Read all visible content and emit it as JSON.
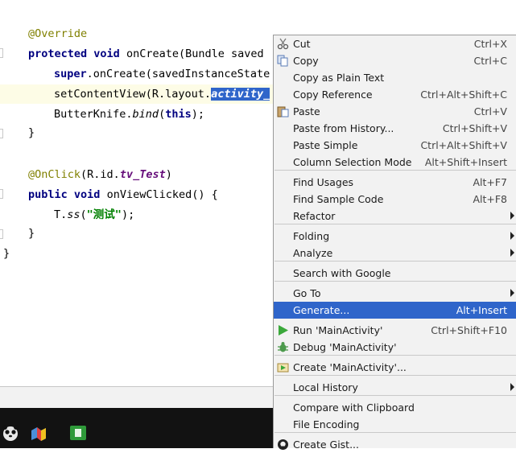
{
  "editor": {
    "lines": [
      {
        "parts": [
          {
            "t": "@Override",
            "c": "ann"
          }
        ]
      },
      {
        "parts": [
          {
            "t": "protected",
            "c": "kw"
          },
          {
            "t": " "
          },
          {
            "t": "void",
            "c": "kw"
          },
          {
            "t": " onCreate(Bundle saved"
          }
        ]
      },
      {
        "parts": [
          {
            "t": "super",
            "c": "kw"
          },
          {
            "t": ".onCreate(savedInstanceState"
          }
        ]
      },
      {
        "parts": [
          {
            "t": "setContentView(R.layout."
          },
          {
            "t": "activity_",
            "c": "fld sel"
          }
        ]
      },
      {
        "parts": [
          {
            "t": "ButterKnife."
          },
          {
            "t": "bind",
            "c": "it"
          },
          {
            "t": "("
          },
          {
            "t": "this",
            "c": "kw"
          },
          {
            "t": ");"
          }
        ]
      },
      {
        "parts": [
          {
            "t": "}"
          }
        ]
      },
      {
        "parts": [
          {
            "t": "@OnClick",
            "c": "ann"
          },
          {
            "t": "(R.id."
          },
          {
            "t": "tv_Test",
            "c": "fld"
          },
          {
            "t": ")"
          }
        ]
      },
      {
        "parts": [
          {
            "t": "public",
            "c": "kw"
          },
          {
            "t": " "
          },
          {
            "t": "void",
            "c": "kw"
          },
          {
            "t": " onViewClicked() {"
          }
        ]
      },
      {
        "parts": [
          {
            "t": "T."
          },
          {
            "t": "ss",
            "c": "it"
          },
          {
            "t": "("
          },
          {
            "t": "\"测试\"",
            "c": "str"
          },
          {
            "t": ");"
          }
        ]
      },
      {
        "parts": [
          {
            "t": "}"
          }
        ]
      },
      {
        "parts": [
          {
            "t": "}"
          }
        ]
      }
    ]
  },
  "context_menu": {
    "items": [
      {
        "label": "Cut",
        "shortcut": "Ctrl+X",
        "icon": "scissors-icon"
      },
      {
        "label": "Copy",
        "shortcut": "Ctrl+C",
        "icon": "copy-icon"
      },
      {
        "label": "Copy as Plain Text",
        "shortcut": ""
      },
      {
        "label": "Copy Reference",
        "shortcut": "Ctrl+Alt+Shift+C"
      },
      {
        "label": "Paste",
        "shortcut": "Ctrl+V",
        "icon": "paste-icon"
      },
      {
        "label": "Paste from History...",
        "shortcut": "Ctrl+Shift+V"
      },
      {
        "label": "Paste Simple",
        "shortcut": "Ctrl+Alt+Shift+V"
      },
      {
        "label": "Column Selection Mode",
        "shortcut": "Alt+Shift+Insert"
      },
      {
        "label": "Find Usages",
        "shortcut": "Alt+F7"
      },
      {
        "label": "Find Sample Code",
        "shortcut": "Alt+F8"
      },
      {
        "label": "Refactor",
        "shortcut": "",
        "submenu": true
      },
      {
        "label": "Folding",
        "shortcut": "",
        "submenu": true
      },
      {
        "label": "Analyze",
        "shortcut": "",
        "submenu": true
      },
      {
        "label": "Search with Google",
        "shortcut": ""
      },
      {
        "label": "Go To",
        "shortcut": "",
        "submenu": true
      },
      {
        "label": "Generate...",
        "shortcut": "Alt+Insert",
        "highlighted": true
      },
      {
        "label": "Run 'MainActivity'",
        "shortcut": "Ctrl+Shift+F10",
        "icon": "run-icon"
      },
      {
        "label": "Debug 'MainActivity'",
        "shortcut": "",
        "icon": "debug-icon"
      },
      {
        "label": "Create 'MainActivity'...",
        "shortcut": "",
        "icon": "run-config-icon"
      },
      {
        "label": "Local History",
        "shortcut": "",
        "submenu": true
      },
      {
        "label": "Compare with Clipboard",
        "shortcut": ""
      },
      {
        "label": "File Encoding",
        "shortcut": ""
      },
      {
        "label": "Create Gist...",
        "shortcut": "",
        "icon": "github-icon"
      }
    ]
  },
  "colors": {
    "selection": "#2f65ca",
    "keyword": "#000080",
    "annotation": "#808000",
    "field": "#660e7a",
    "string": "#008000"
  },
  "taskbar": {
    "icons": [
      "panda-app-icon",
      "map-app-icon",
      "green-app-icon"
    ]
  }
}
